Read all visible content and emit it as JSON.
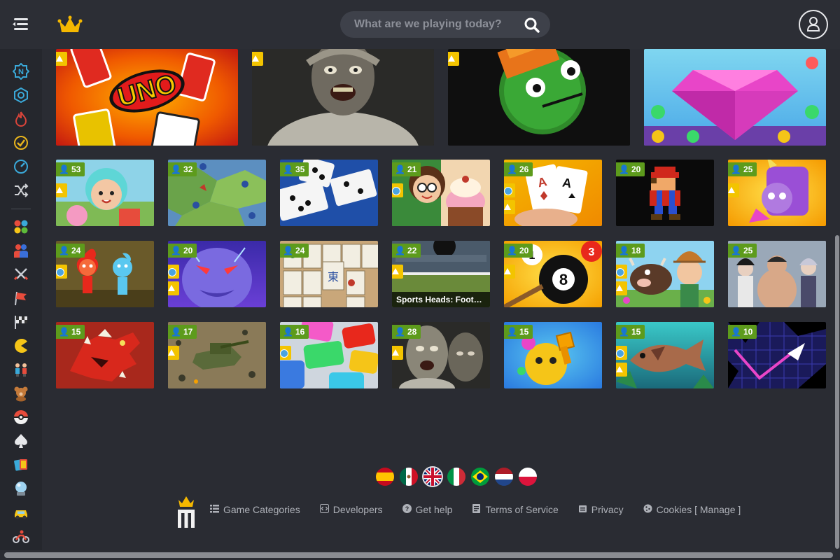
{
  "header": {
    "search_placeholder": "What are we playing today?"
  },
  "sidebar": {
    "items": [
      {
        "icon": "new-icon",
        "color": "#3aa9d9"
      },
      {
        "icon": "updated-icon",
        "color": "#3aa9d9"
      },
      {
        "icon": "trending-flame-icon",
        "color": "#d9443a"
      },
      {
        "icon": "played-check-icon",
        "color": "#e8b41c"
      },
      {
        "icon": "speed-gauge-icon",
        "color": "#3aa9d9"
      },
      {
        "icon": "shuffle-icon",
        "color": "#d0d2d6"
      },
      {
        "icon": "categories-dots-icon",
        "color": "#e74c3c"
      },
      {
        "icon": "two-player-icon",
        "color": "#e74c3c"
      },
      {
        "icon": "swords-icon",
        "color": "#c9ccd3"
      },
      {
        "icon": "flag-icon",
        "color": "#e74c3c"
      },
      {
        "icon": "racing-flag-icon",
        "color": "#c9ccd3"
      },
      {
        "icon": "pacman-icon",
        "color": "#f5c518"
      },
      {
        "icon": "kids-icon",
        "color": "#3aa9d9"
      },
      {
        "icon": "teddy-bear-icon",
        "color": "#c47a3a"
      },
      {
        "icon": "pokeball-icon",
        "color": "#e74c3c"
      },
      {
        "icon": "spade-icon",
        "color": "#e6e7ea"
      },
      {
        "icon": "cards-icon",
        "color": "#3aa9d9"
      },
      {
        "icon": "crystal-ball-icon",
        "color": "#9fd3f0"
      },
      {
        "icon": "car-icon",
        "color": "#f5c518"
      },
      {
        "icon": "motorbike-icon",
        "color": "#e74c3c"
      }
    ]
  },
  "games_top": [
    {
      "name": "uno",
      "badge": "hot"
    },
    {
      "name": "granny",
      "badge": "hot"
    },
    {
      "name": "pixel-melon",
      "badge": "hot"
    },
    {
      "name": "jewels",
      "badge": ""
    }
  ],
  "games": [
    {
      "players": "53",
      "extra": "hot"
    },
    {
      "players": "32",
      "extra": ""
    },
    {
      "players": "35",
      "extra": ""
    },
    {
      "players": "21",
      "extra": "blue"
    },
    {
      "players": "26",
      "extra": "both"
    },
    {
      "players": "20",
      "extra": ""
    },
    {
      "players": "25",
      "extra": "hot"
    },
    {
      "players": "24",
      "extra": "blue"
    },
    {
      "players": "20",
      "extra": "both"
    },
    {
      "players": "24",
      "extra": ""
    },
    {
      "players": "22",
      "extra": "hot",
      "title": "Sports Heads: Footbal..."
    },
    {
      "players": "20",
      "extra": "hot"
    },
    {
      "players": "18",
      "extra": "both"
    },
    {
      "players": "25",
      "extra": ""
    },
    {
      "players": "15",
      "extra": ""
    },
    {
      "players": "17",
      "extra": "hot"
    },
    {
      "players": "16",
      "extra": "blue"
    },
    {
      "players": "28",
      "extra": "hot"
    },
    {
      "players": "15",
      "extra": ""
    },
    {
      "players": "15",
      "extra": "both"
    },
    {
      "players": "10",
      "extra": ""
    }
  ],
  "languages": [
    {
      "code": "es",
      "selected": false
    },
    {
      "code": "mx",
      "selected": false
    },
    {
      "code": "gb",
      "selected": true
    },
    {
      "code": "it",
      "selected": false
    },
    {
      "code": "br",
      "selected": false
    },
    {
      "code": "nl",
      "selected": false
    },
    {
      "code": "pl",
      "selected": false
    }
  ],
  "footer": {
    "links": [
      {
        "label": "Game Categories",
        "icon": "list-icon"
      },
      {
        "label": "Developers",
        "icon": "code-icon"
      },
      {
        "label": "Get help",
        "icon": "help-icon"
      },
      {
        "label": "Terms of Service",
        "icon": "document-icon"
      },
      {
        "label": "Privacy",
        "icon": "lock-icon"
      },
      {
        "label": "Cookies [ Manage ]",
        "icon": "cookie-icon"
      }
    ]
  }
}
